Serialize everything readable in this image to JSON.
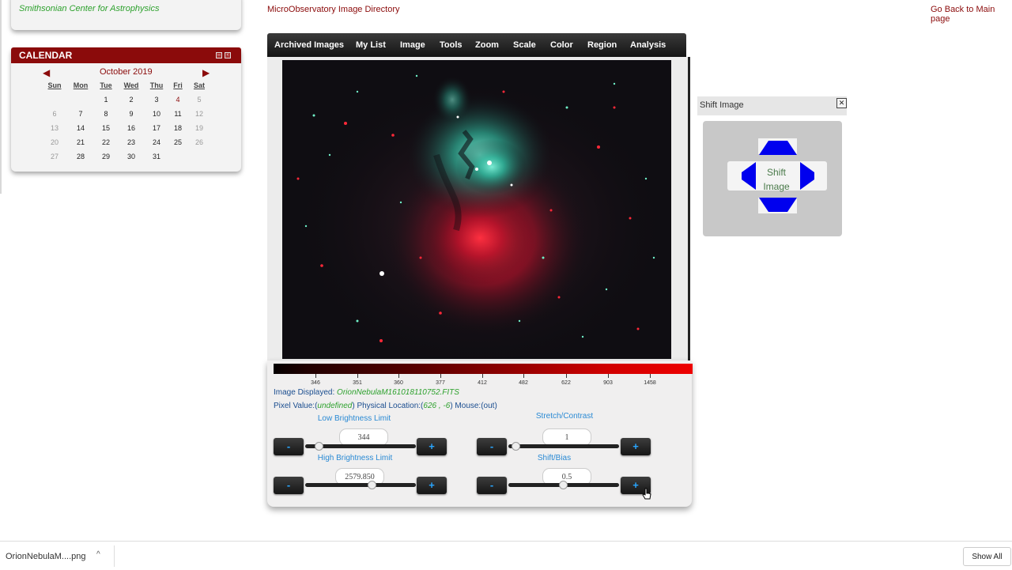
{
  "org": {
    "name": "Smithsonian Center for Astrophysics"
  },
  "calendar": {
    "title": "CALENDAR",
    "month_label": "October 2019",
    "prev": "◀",
    "next": "▶",
    "weekdays": [
      "Sun",
      "Mon",
      "Tue",
      "Wed",
      "Thu",
      "Fri",
      "Sat"
    ],
    "weeks": [
      [
        "",
        "",
        "1",
        "2",
        "3",
        "4",
        "5"
      ],
      [
        "6",
        "7",
        "8",
        "9",
        "10",
        "11",
        "12"
      ],
      [
        "13",
        "14",
        "15",
        "16",
        "17",
        "18",
        "19"
      ],
      [
        "20",
        "21",
        "22",
        "23",
        "24",
        "25",
        "26"
      ],
      [
        "27",
        "28",
        "29",
        "30",
        "31",
        "",
        ""
      ]
    ]
  },
  "header": {
    "directory_link": "MicroObservatory Image Directory",
    "back_link": "Go Back to Main page"
  },
  "menu": [
    "Archived Images",
    "My List",
    "Image",
    "Tools",
    "Zoom",
    "Scale",
    "Color",
    "Region",
    "Analysis"
  ],
  "colorbar": {
    "ticks": [
      "346",
      "351",
      "360",
      "377",
      "412",
      "482",
      "622",
      "903",
      "1458"
    ]
  },
  "info": {
    "image_displayed_label": "Image Displayed:",
    "image_displayed_value": "OrionNebulaM161018110752.FITS",
    "pixel_value_label": "Pixel Value:(",
    "pixel_value_value": "undefined",
    "physical_label": ") Physical Location:(",
    "physical_value": "626 , -6",
    "mouse_label": ") Mouse:(out)"
  },
  "controls": {
    "low_brightness": {
      "label": "Low Brightness Limit",
      "value": "344"
    },
    "high_brightness": {
      "label": "High Brightness Limit",
      "value": "2579.850"
    },
    "stretch": {
      "label": "Stretch/Contrast",
      "value": "1"
    },
    "shift": {
      "label": "Shift/Bias",
      "value": "0.5"
    },
    "minus": "-",
    "plus": "+"
  },
  "shift_panel": {
    "title": "Shift Image",
    "close": "✕",
    "center_text": "Shift Image"
  },
  "downloads": {
    "file": "OrionNebulaM....png",
    "caret": "^",
    "show_all": "Show All"
  }
}
